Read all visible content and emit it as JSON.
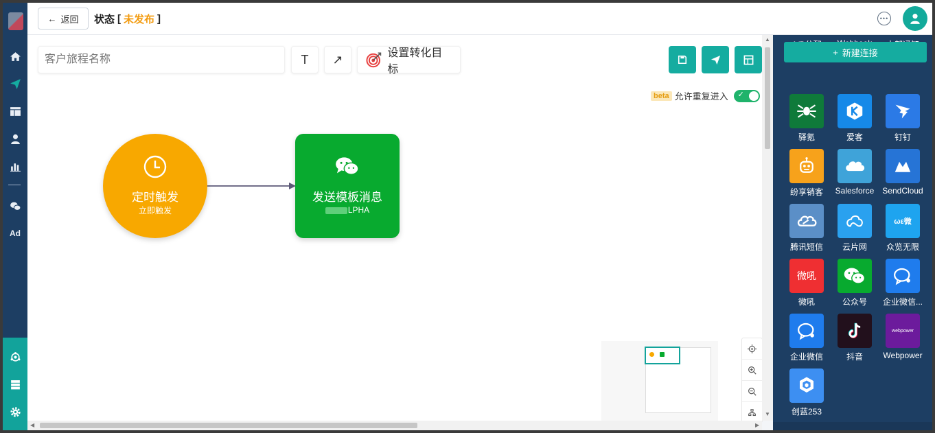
{
  "header": {
    "back_label": "返回",
    "status_label": "状态",
    "status_open": "[",
    "status_value": "未发布",
    "status_close": "]"
  },
  "toolbar": {
    "journey_name_placeholder": "客户旅程名称",
    "text_tool_label": "T",
    "arrow_tool_label": "↗",
    "goal_label": "设置转化目标"
  },
  "options": {
    "beta_badge": "beta",
    "reentry_label": "允许重复进入",
    "reentry_enabled": true
  },
  "nodes": {
    "trigger": {
      "title": "定时触发",
      "subtitle": "立即触发",
      "color": "#f8a800"
    },
    "action": {
      "title": "发送模板消息",
      "subtitle": "LPHA",
      "color": "#08aa2f"
    }
  },
  "panel": {
    "new_connection_label": "新建连接",
    "partial_apps": [
      "A/B分配",
      "Webhook",
      "内部通知"
    ],
    "apps": [
      {
        "label": "驿氪",
        "icon": "spider-icon",
        "color": "#0f7a3a"
      },
      {
        "label": "爱客",
        "icon": "k-icon",
        "color": "#1689e8"
      },
      {
        "label": "钉钉",
        "icon": "dingtalk-icon",
        "color": "#2b7ae6"
      },
      {
        "label": "纷享销客",
        "icon": "robot-icon",
        "color": "#f7a21b"
      },
      {
        "label": "Salesforce",
        "icon": "cloud-icon",
        "color": "#3fa3d9"
      },
      {
        "label": "SendCloud",
        "icon": "sendcloud-icon",
        "color": "#2674d6"
      },
      {
        "label": "腾讯短信",
        "icon": "tencent-cloud-icon",
        "color": "#5b8fc7"
      },
      {
        "label": "云片网",
        "icon": "yunpian-icon",
        "color": "#2aa1ef"
      },
      {
        "label": "众览无限",
        "icon": "zhonglan-icon",
        "color": "#1ea4ef"
      },
      {
        "label": "微吼",
        "icon": "weihou-icon",
        "color": "#ef2f32"
      },
      {
        "label": "公众号",
        "icon": "wechat-icon",
        "color": "#08aa2f"
      },
      {
        "label": "企业微信...",
        "icon": "wecom-icon",
        "color": "#1f7ced"
      },
      {
        "label": "企业微信",
        "icon": "wecom-icon",
        "color": "#1f7ced"
      },
      {
        "label": "抖音",
        "icon": "tiktok-icon",
        "color": "#22101c"
      },
      {
        "label": "Webpower",
        "icon": "webpower-icon",
        "color": "#6c1b9c"
      },
      {
        "label": "创蓝253",
        "icon": "chuanglan-icon",
        "color": "#3d8ff2"
      }
    ],
    "tile_texts": {
      "weihou": "微吼",
      "zhonglan": "ωε微",
      "webpower": "webpower"
    }
  }
}
